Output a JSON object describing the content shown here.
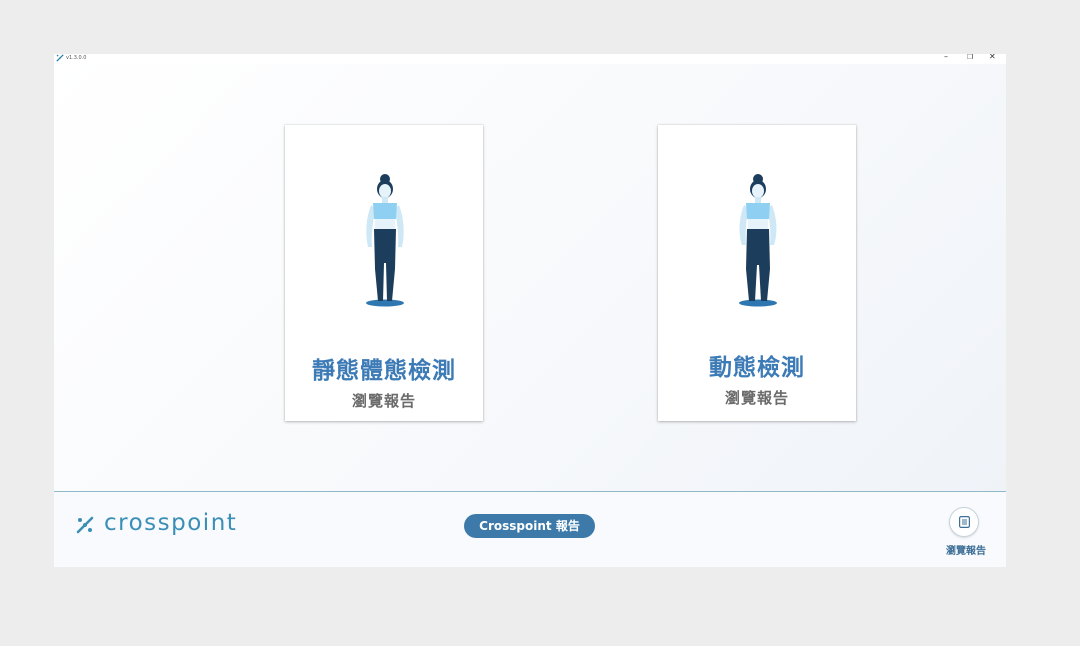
{
  "titlebar": {
    "version": "v1.3.0.0",
    "minimize_label": "–",
    "maximize_label": "❐",
    "close_label": "✕"
  },
  "cards": {
    "static": {
      "title": "靜態體態檢測",
      "subtitle": "瀏覽報告",
      "icon": "standing-figure-icon"
    },
    "dynamic": {
      "title": "動態檢測",
      "subtitle": "瀏覽報告",
      "icon": "standing-figure-icon"
    }
  },
  "footer": {
    "brand": "crosspoint",
    "report_button": "Crosspoint 報告",
    "browse_label": "瀏覽報告",
    "browse_icon": "document-icon"
  },
  "colors": {
    "accent": "#3d7bb6",
    "brand": "#3b8fb7",
    "pill": "#3d7aa9"
  }
}
